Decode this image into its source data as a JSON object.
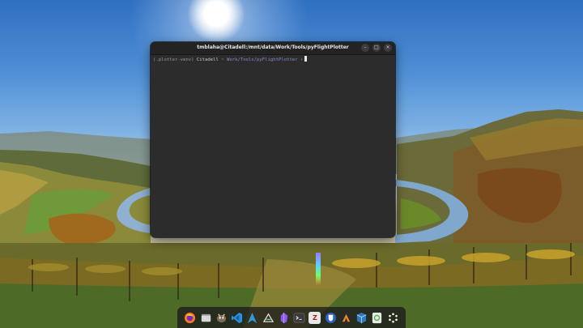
{
  "terminal": {
    "title": "tmblaha@Citadell:/mnt/data/Work/Tools/pyFlightPlotter",
    "prompt": {
      "venv": "(.plotter-venv)",
      "host": "Citadell",
      "separator": "~",
      "path": "Work/Tools/pyFlightPlotter",
      "end": "›"
    },
    "buttons": {
      "minimize": "–",
      "maximize": "□",
      "close": "×"
    }
  },
  "dock": {
    "apps": [
      {
        "name": "firefox-icon",
        "glyph": "",
        "color": "#ff7a1a"
      },
      {
        "name": "files-icon",
        "glyph": "",
        "color": "#8b8b8b"
      },
      {
        "name": "gimp-icon",
        "glyph": "",
        "color": "#8a6a4a"
      },
      {
        "name": "vscode-icon",
        "glyph": "",
        "color": "#2a8fe0"
      },
      {
        "name": "arch-icon",
        "glyph": "",
        "color": "#2f9ad8"
      },
      {
        "name": "inkscape-icon",
        "glyph": "",
        "color": "#e8e8e8"
      },
      {
        "name": "obsidian-icon",
        "glyph": "",
        "color": "#8a5cf0"
      },
      {
        "name": "terminal-icon",
        "glyph": "",
        "color": "#3a3a3a"
      },
      {
        "name": "zotero-icon",
        "glyph": "Z",
        "color": "#d8d8d8"
      },
      {
        "name": "bitwarden-icon",
        "glyph": "",
        "color": "#2e5fbf"
      },
      {
        "name": "altium-icon",
        "glyph": "",
        "color": "#f08a1e"
      },
      {
        "name": "virtualbox-icon",
        "glyph": "",
        "color": "#2f79c2"
      },
      {
        "name": "backup-icon",
        "glyph": "",
        "color": "#5fb04a"
      },
      {
        "name": "app-grid-icon",
        "glyph": "",
        "color": "#ffffff"
      }
    ]
  }
}
